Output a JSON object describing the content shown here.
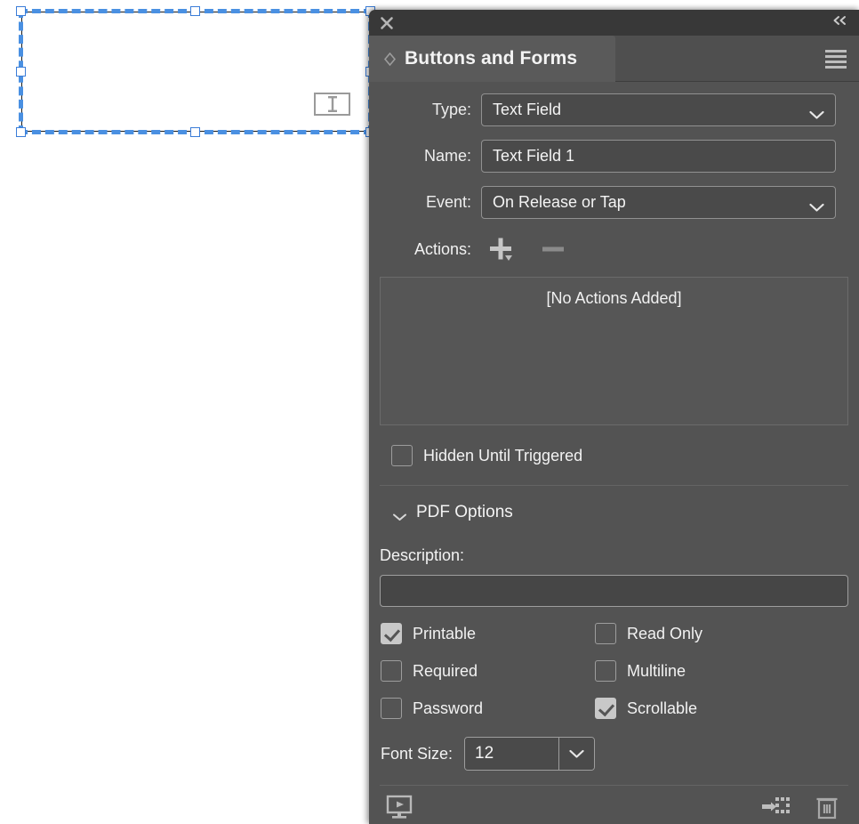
{
  "panel": {
    "close_icon": "close-icon",
    "collapse_icon": "collapse-double-chevron",
    "tab_title": "Buttons and Forms",
    "menu_icon": "panel-menu-icon",
    "colors": {
      "panel_bg": "#535353",
      "header_bg": "#383838",
      "tab_active_bg": "#5a5a5a",
      "field_bg": "#4a4a4a",
      "field_border": "#919191",
      "text": "#f2f2f2",
      "selection_blue": "#4a90e2"
    }
  },
  "form": {
    "type_label": "Type:",
    "type_value": "Text Field",
    "name_label": "Name:",
    "name_value": "Text Field 1",
    "event_label": "Event:",
    "event_value": "On Release or Tap",
    "actions_label": "Actions:",
    "add_action_icon": "plus-icon",
    "remove_action_icon": "minus-icon",
    "actions_empty_text": "[No Actions Added]",
    "hidden_until_triggered_label": "Hidden Until Triggered",
    "hidden_until_triggered_checked": false
  },
  "pdf_options": {
    "title": "PDF Options",
    "expanded": true,
    "description_label": "Description:",
    "description_value": "",
    "checkboxes": [
      {
        "label": "Printable",
        "checked": true
      },
      {
        "label": "Read Only",
        "checked": false
      },
      {
        "label": "Required",
        "checked": false
      },
      {
        "label": "Multiline",
        "checked": false
      },
      {
        "label": "Password",
        "checked": false
      },
      {
        "label": "Scrollable",
        "checked": true
      }
    ],
    "font_size_label": "Font Size:",
    "font_size_value": "12"
  },
  "footer": {
    "preview_icon": "preview-spread-icon",
    "convert_icon": "convert-to-object-icon",
    "delete_icon": "trash-icon"
  },
  "canvas": {
    "object_badge_icon": "text-field-badge-icon",
    "selection_handles": 8
  }
}
